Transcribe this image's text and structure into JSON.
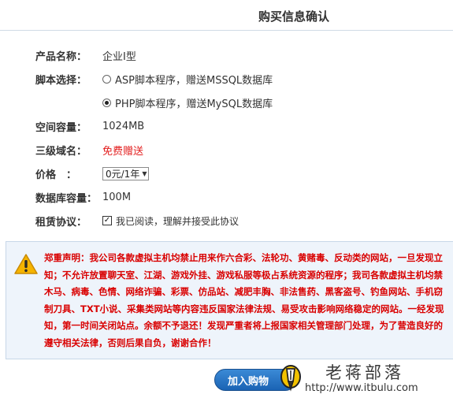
{
  "page": {
    "title": "购买信息确认"
  },
  "form": {
    "product": {
      "label": "产品名称：",
      "value": "企业I型"
    },
    "script": {
      "label": "脚本选择：",
      "options": [
        {
          "label": "ASP脚本程序，赠送MSSQL数据库",
          "checked": false
        },
        {
          "label": "PHP脚本程序，赠送MySQL数据库",
          "checked": true
        }
      ]
    },
    "space": {
      "label": "空间容量：",
      "value": "1024MB"
    },
    "subdomain": {
      "label": "三级域名：",
      "value": "免费赠送"
    },
    "price": {
      "label": "价格　：",
      "selected": "0元/1年"
    },
    "db_capacity": {
      "label": "数据库容量：",
      "value": "100M"
    },
    "agreement": {
      "label": "租赁协议：",
      "checkbox_label": "我已阅读，理解并接受此协议",
      "checked": true
    }
  },
  "notice": {
    "lines": [
      "郑重声明：我公司各款虚拟主机均禁止用来作六合彩、法轮功、黄赌毒、反动类的网站，一旦发现立",
      "知；不允许放置聊天室、江湖、游戏外挂、游戏私服等极占系统资源的程序；我司各款虚拟主机均禁",
      "木马、病毒、色情、网络诈骗、彩票、仿品站、减肥丰胸、非法售药、黑客盗号、钓鱼网站、手机窃",
      "制刀具、TXT小说、采集类网站等内容违反国家法律法规、易受攻击影响网络稳定的网站。一经发现",
      "知，第一时间关闭站点。余额不予退还！发现严重者将上报国家相关管理部门处理，为了营造良好的",
      "遵守相关法律，否则后果自负，谢谢合作！"
    ]
  },
  "submit": {
    "label": "加入购物"
  },
  "watermark": {
    "name": "老蒋部落",
    "url": "http://www.itbulu.com"
  },
  "colors": {
    "accent_blue": "#1a63b4",
    "warning_red": "#d90000",
    "notice_bg": "#eef4fb"
  }
}
